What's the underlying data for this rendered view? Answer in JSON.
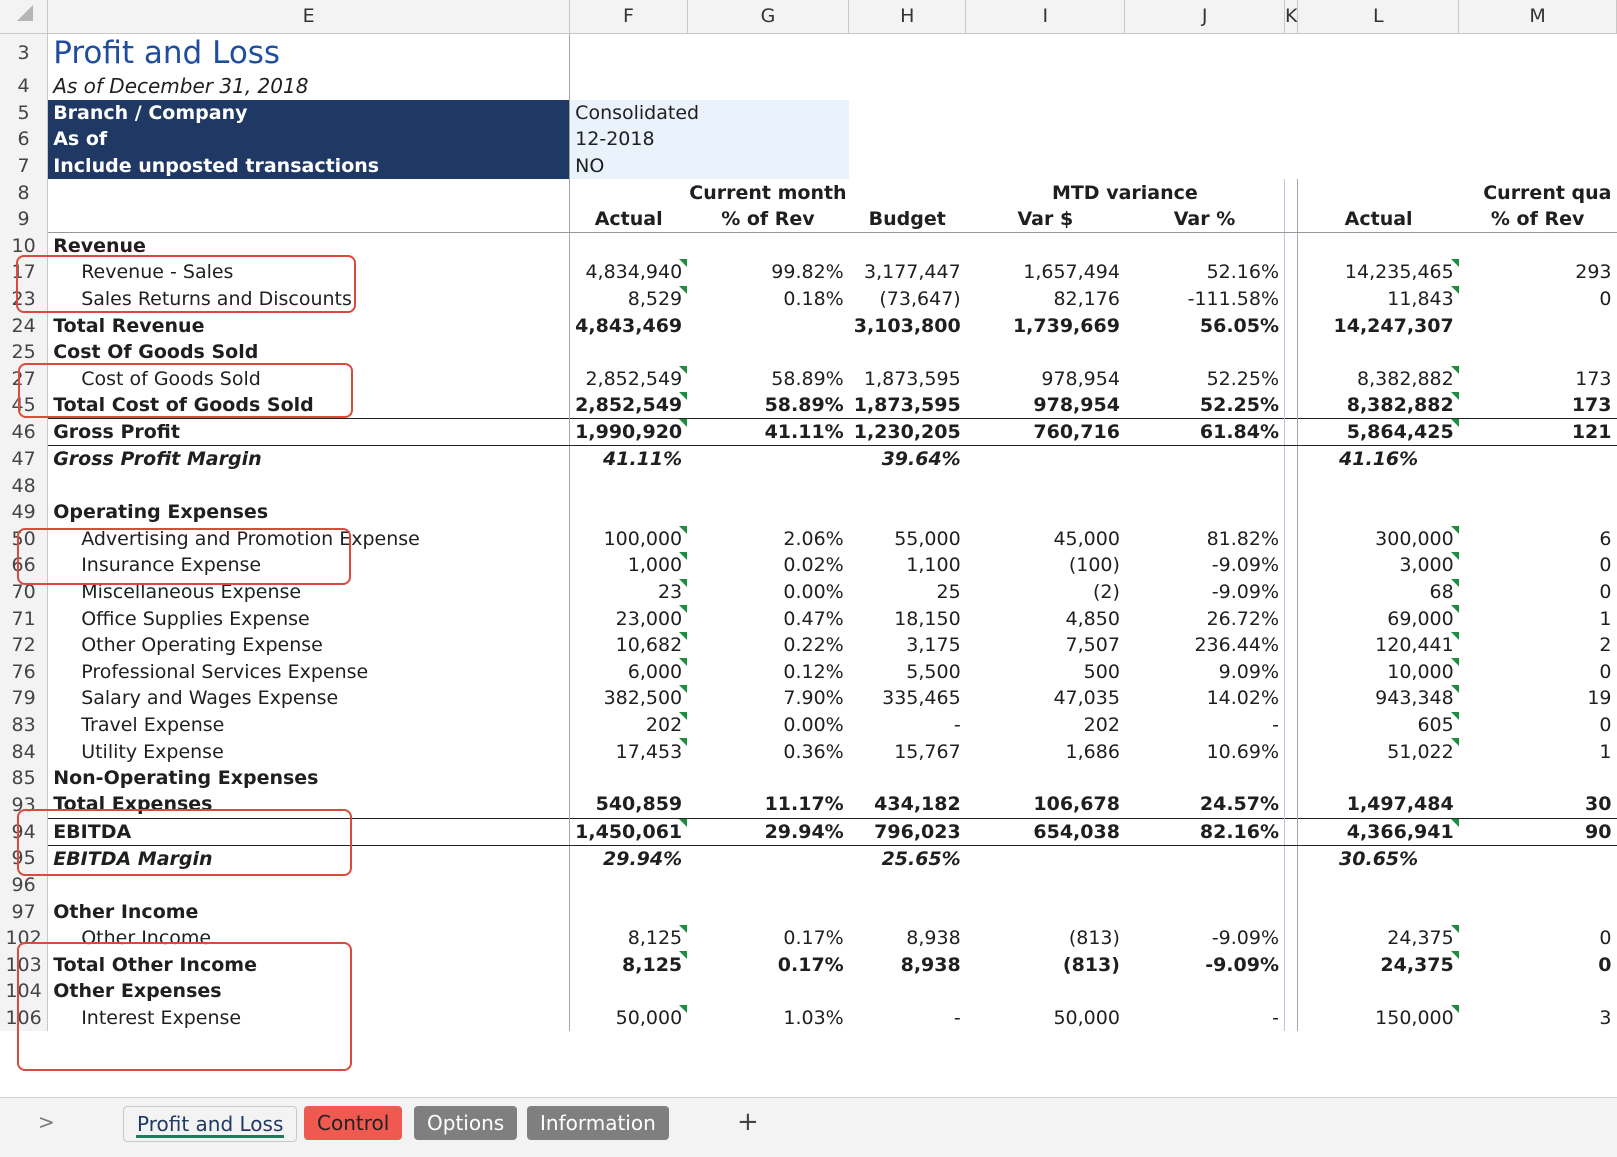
{
  "columns": [
    "E",
    "F",
    "G",
    "H",
    "I",
    "J",
    "K",
    "L",
    "M"
  ],
  "report": {
    "title": "Profit and Loss",
    "subtitle": "As of December 31, 2018",
    "params": [
      {
        "row": "5",
        "label": "Branch / Company",
        "value": "Consolidated"
      },
      {
        "row": "6",
        "label": "As of",
        "value": "12-2018"
      },
      {
        "row": "7",
        "label": "Include unposted transactions",
        "value": "NO"
      }
    ]
  },
  "groups": {
    "current_month": "Current month",
    "mtd_variance": "MTD variance",
    "current_quarter": "Current qua"
  },
  "col_headers": {
    "actual": "Actual",
    "pct_rev": "% of Rev",
    "budget": "Budget",
    "var_dollar": "Var $",
    "var_pct": "Var %",
    "q_actual": "Actual",
    "q_pct_rev": "% of Rev"
  },
  "row_numbers": {
    "r3": "3",
    "r4": "4",
    "r8": "8",
    "r9": "9"
  },
  "lines": [
    {
      "row": "10",
      "label": "Revenue",
      "actual": "",
      "pct": "",
      "budget": "",
      "var": "",
      "varpct": "",
      "qactual": "",
      "qpct": ""
    },
    {
      "row": "17",
      "label": "Revenue - Sales",
      "actual": "4,834,940",
      "pct": "99.82%",
      "budget": "3,177,447",
      "var": "1,657,494",
      "varpct": "52.16%",
      "qactual": "14,235,465",
      "qpct": "293"
    },
    {
      "row": "23",
      "label": "Sales Returns and Discounts",
      "actual": "8,529",
      "pct": "0.18%",
      "budget": "(73,647)",
      "var": "82,176",
      "varpct": "-111.58%",
      "qactual": "11,843",
      "qpct": "0"
    },
    {
      "row": "24",
      "label": "Total Revenue",
      "actual": "4,843,469",
      "pct": "",
      "budget": "3,103,800",
      "var": "1,739,669",
      "varpct": "56.05%",
      "qactual": "14,247,307",
      "qpct": ""
    },
    {
      "row": "25",
      "label": "Cost Of Goods Sold",
      "actual": "",
      "pct": "",
      "budget": "",
      "var": "",
      "varpct": "",
      "qactual": "",
      "qpct": ""
    },
    {
      "row": "27",
      "label": "Cost of Goods Sold",
      "actual": "2,852,549",
      "pct": "58.89%",
      "budget": "1,873,595",
      "var": "978,954",
      "varpct": "52.25%",
      "qactual": "8,382,882",
      "qpct": "173"
    },
    {
      "row": "45",
      "label": "Total Cost of Goods Sold",
      "actual": "2,852,549",
      "pct": "58.89%",
      "budget": "1,873,595",
      "var": "978,954",
      "varpct": "52.25%",
      "qactual": "8,382,882",
      "qpct": "173"
    },
    {
      "row": "46",
      "label": "Gross Profit",
      "actual": "1,990,920",
      "pct": "41.11%",
      "budget": "1,230,205",
      "var": "760,716",
      "varpct": "61.84%",
      "qactual": "5,864,425",
      "qpct": "121"
    },
    {
      "row": "47",
      "label": "Gross Profit Margin",
      "actual": "41.11%",
      "pct": "",
      "budget": "39.64%",
      "var": "",
      "varpct": "",
      "qactual": "41.16%",
      "qpct": ""
    },
    {
      "row": "48",
      "label": "",
      "actual": "",
      "pct": "",
      "budget": "",
      "var": "",
      "varpct": "",
      "qactual": "",
      "qpct": ""
    },
    {
      "row": "49",
      "label": "Operating Expenses",
      "actual": "",
      "pct": "",
      "budget": "",
      "var": "",
      "varpct": "",
      "qactual": "",
      "qpct": ""
    },
    {
      "row": "50",
      "label": "Advertising and Promotion Expense",
      "actual": "100,000",
      "pct": "2.06%",
      "budget": "55,000",
      "var": "45,000",
      "varpct": "81.82%",
      "qactual": "300,000",
      "qpct": "6"
    },
    {
      "row": "66",
      "label": "Insurance Expense",
      "actual": "1,000",
      "pct": "0.02%",
      "budget": "1,100",
      "var": "(100)",
      "varpct": "-9.09%",
      "qactual": "3,000",
      "qpct": "0"
    },
    {
      "row": "70",
      "label": "Miscellaneous Expense",
      "actual": "23",
      "pct": "0.00%",
      "budget": "25",
      "var": "(2)",
      "varpct": "-9.09%",
      "qactual": "68",
      "qpct": "0"
    },
    {
      "row": "71",
      "label": "Office Supplies Expense",
      "actual": "23,000",
      "pct": "0.47%",
      "budget": "18,150",
      "var": "4,850",
      "varpct": "26.72%",
      "qactual": "69,000",
      "qpct": "1"
    },
    {
      "row": "72",
      "label": "Other Operating Expense",
      "actual": "10,682",
      "pct": "0.22%",
      "budget": "3,175",
      "var": "7,507",
      "varpct": "236.44%",
      "qactual": "120,441",
      "qpct": "2"
    },
    {
      "row": "76",
      "label": "Professional Services Expense",
      "actual": "6,000",
      "pct": "0.12%",
      "budget": "5,500",
      "var": "500",
      "varpct": "9.09%",
      "qactual": "10,000",
      "qpct": "0"
    },
    {
      "row": "79",
      "label": "Salary and Wages Expense",
      "actual": "382,500",
      "pct": "7.90%",
      "budget": "335,465",
      "var": "47,035",
      "varpct": "14.02%",
      "qactual": "943,348",
      "qpct": "19"
    },
    {
      "row": "83",
      "label": "Travel Expense",
      "actual": "202",
      "pct": "0.00%",
      "budget": "-",
      "var": "202",
      "varpct": "-",
      "qactual": "605",
      "qpct": "0"
    },
    {
      "row": "84",
      "label": "Utility Expense",
      "actual": "17,453",
      "pct": "0.36%",
      "budget": "15,767",
      "var": "1,686",
      "varpct": "10.69%",
      "qactual": "51,022",
      "qpct": "1"
    },
    {
      "row": "85",
      "label": "Non-Operating Expenses",
      "actual": "",
      "pct": "",
      "budget": "",
      "var": "",
      "varpct": "",
      "qactual": "",
      "qpct": ""
    },
    {
      "row": "93",
      "label": "Total Expenses",
      "actual": "540,859",
      "pct": "11.17%",
      "budget": "434,182",
      "var": "106,678",
      "varpct": "24.57%",
      "qactual": "1,497,484",
      "qpct": "30"
    },
    {
      "row": "94",
      "label": "EBITDA",
      "actual": "1,450,061",
      "pct": "29.94%",
      "budget": "796,023",
      "var": "654,038",
      "varpct": "82.16%",
      "qactual": "4,366,941",
      "qpct": "90"
    },
    {
      "row": "95",
      "label": "EBITDA Margin",
      "actual": "29.94%",
      "pct": "",
      "budget": "25.65%",
      "var": "",
      "varpct": "",
      "qactual": "30.65%",
      "qpct": ""
    },
    {
      "row": "96",
      "label": "",
      "actual": "",
      "pct": "",
      "budget": "",
      "var": "",
      "varpct": "",
      "qactual": "",
      "qpct": ""
    },
    {
      "row": "97",
      "label": "Other Income",
      "actual": "",
      "pct": "",
      "budget": "",
      "var": "",
      "varpct": "",
      "qactual": "",
      "qpct": ""
    },
    {
      "row": "102",
      "label": "Other Income",
      "actual": "8,125",
      "pct": "0.17%",
      "budget": "8,938",
      "var": "(813)",
      "varpct": "-9.09%",
      "qactual": "24,375",
      "qpct": "0"
    },
    {
      "row": "103",
      "label": "Total Other Income",
      "actual": "8,125",
      "pct": "0.17%",
      "budget": "8,938",
      "var": "(813)",
      "varpct": "-9.09%",
      "qactual": "24,375",
      "qpct": "0"
    },
    {
      "row": "104",
      "label": "Other Expenses",
      "actual": "",
      "pct": "",
      "budget": "",
      "var": "",
      "varpct": "",
      "qactual": "",
      "qpct": ""
    },
    {
      "row": "106",
      "label": "Interest Expense",
      "actual": "50,000",
      "pct": "1.03%",
      "budget": "-",
      "var": "50,000",
      "varpct": "-",
      "qactual": "150,000",
      "qpct": "3"
    }
  ],
  "tabs": {
    "nav": ">",
    "items": [
      {
        "label": "Profit and Loss",
        "active": true,
        "color": "#f3f3f3"
      },
      {
        "label": "Control",
        "active": false,
        "color": "#f0594f"
      },
      {
        "label": "Options",
        "active": false,
        "color": "#7f7f7f"
      },
      {
        "label": "Information",
        "active": false,
        "color": "#7f7f7f"
      }
    ],
    "add": "+"
  },
  "colors": {
    "title_blue": "#1f4e9e",
    "header_navy": "#1f3864",
    "param_fill": "#eaf2fb",
    "annotation_red": "#d94b3b",
    "comment_green": "#1e8e3e"
  }
}
